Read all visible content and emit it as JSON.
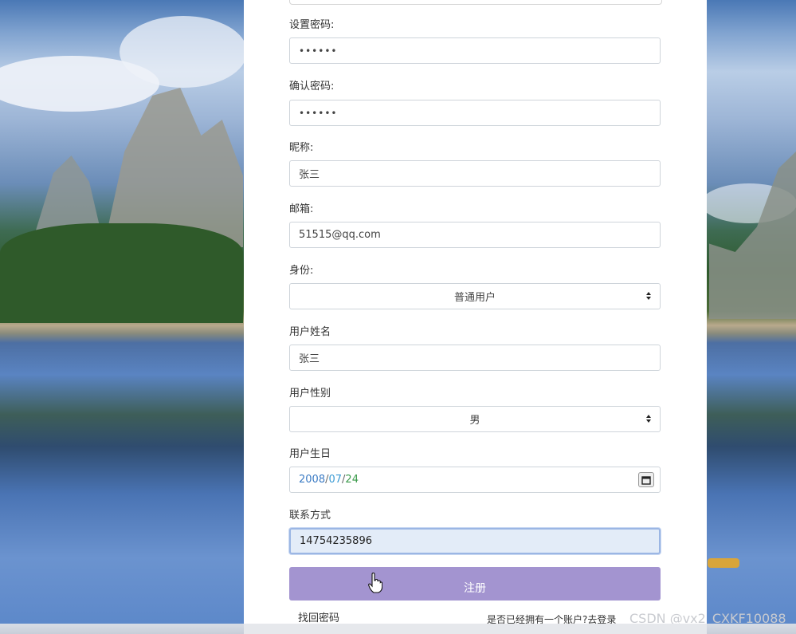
{
  "form": {
    "set_password": {
      "label": "设置密码:",
      "value": "••••••"
    },
    "confirm_password": {
      "label": "确认密码:",
      "value": "••••••"
    },
    "nickname": {
      "label": "昵称:",
      "value": "张三"
    },
    "email": {
      "label": "邮箱:",
      "value": "51515@qq.com"
    },
    "role": {
      "label": "身份:",
      "value": "普通用户"
    },
    "real_name": {
      "label": "用户姓名",
      "value": "张三"
    },
    "gender": {
      "label": "用户性别",
      "value": "男"
    },
    "birthday": {
      "label": "用户生日",
      "year": "2008",
      "month": "07",
      "day": "24",
      "separator": "/"
    },
    "phone": {
      "label": "联系方式",
      "value": "14754235896"
    },
    "submit_label": "注册",
    "forgot_password": "找回密码",
    "login_link": "是否已经拥有一个账户?去登录"
  },
  "watermark": "CSDN @vx2_CXKF10088",
  "colors": {
    "submit_bg": "#a394d0",
    "focus_bg": "#e3ecf8",
    "focus_border": "#9bb6e4"
  },
  "icons": {
    "calendar": "calendar-icon",
    "select_arrows": "select-arrows-icon",
    "cursor": "hand-pointer-icon"
  }
}
